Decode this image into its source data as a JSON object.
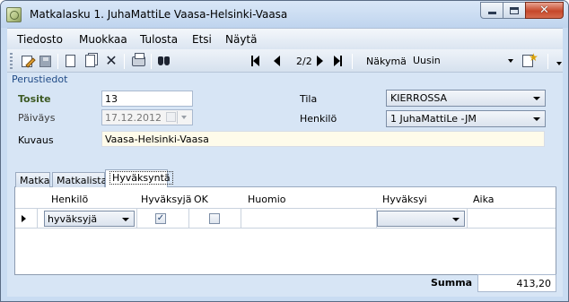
{
  "window": {
    "title": "Matkalasku 1. JuhaMattiLe Vaasa-Helsinki-Vaasa",
    "controls": [
      "minimize-icon",
      "maximize-icon",
      "close-icon"
    ]
  },
  "menu": [
    "Tiedosto",
    "Muokkaa",
    "Tulosta",
    "Etsi",
    "Näytä"
  ],
  "toolbar": {
    "icons": [
      "edit-icon",
      "save-icon",
      "new-document-icon",
      "copy-document-icon",
      "delete-icon",
      "print-icon",
      "find-icon"
    ],
    "navigation": {
      "record": "2/2",
      "buttons": [
        "first-record-icon",
        "previous-record-icon",
        "next-record-icon",
        "last-record-icon"
      ]
    },
    "view_label": "Näkymä",
    "view_value": "Uusin",
    "view_settings_icon": "view-settings-icon"
  },
  "basic_info": {
    "group_title": "Perustiedot",
    "tosite_label": "Tosite",
    "tosite_value": "13",
    "date_label": "Päiväys",
    "date_value": "17.12.2012",
    "desc_label": "Kuvaus",
    "desc_value": "Vaasa-Helsinki-Vaasa",
    "status_label": "Tila",
    "status_value": "KIERROSSA",
    "person_label": "Henkilö",
    "person_value": "1 JuhaMattiLe -JM"
  },
  "tabs": [
    {
      "label": "Matka",
      "active": false
    },
    {
      "label": "Matkalista",
      "active": false
    },
    {
      "label": "Hyväksyntä",
      "active": true
    }
  ],
  "approval_grid": {
    "columns": [
      "Henkilö",
      "Hyväksyjä",
      "OK",
      "Huomio",
      "Hyväksyi",
      "Aika"
    ],
    "rows": [
      {
        "henkilo": "hyväksyjä",
        "hyvaksyja": true,
        "ok": false,
        "huomio": "",
        "hyvaksyi": "",
        "aika": ""
      }
    ]
  },
  "footer": {
    "sum_label": "Summa",
    "sum_value": "413,20"
  },
  "colors": {
    "panel_bg": "#d7e5f5",
    "title_label": "#1f4a86",
    "tosite_label": "#3d5a24",
    "close_button": "#c6472a"
  }
}
